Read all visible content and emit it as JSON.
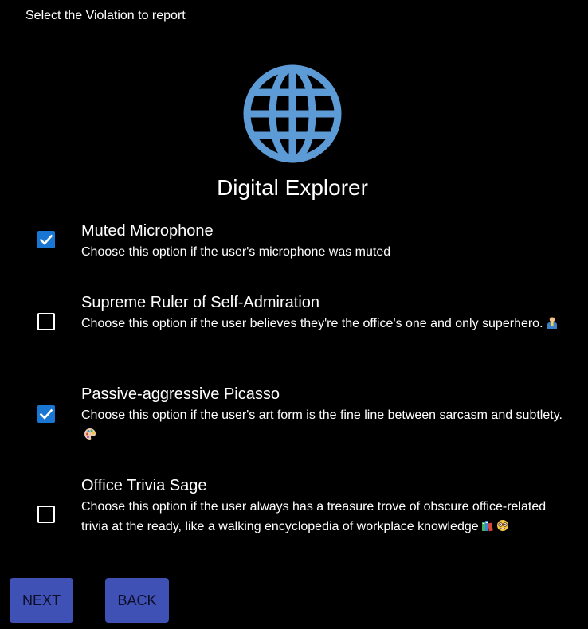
{
  "header": {
    "prompt": "Select the Violation to report"
  },
  "profile": {
    "icon": "globe-icon",
    "name": "Digital Explorer",
    "accent": "#5c9bd6"
  },
  "options": [
    {
      "title": "Muted Microphone",
      "description": "Choose this option if the user's microphone was muted",
      "checked": true
    },
    {
      "title": "Supreme Ruler of Self-Admiration",
      "description": "Choose this option if the user believes they're the office's one and only superhero.",
      "emoji": [
        "superhero-emoji"
      ],
      "checked": false
    },
    {
      "title": "Passive-aggressive Picasso",
      "description": "Choose this option if the user's art form is the fine line between sarcasm and subtlety.",
      "emoji": [
        "artist-palette-emoji"
      ],
      "checked": true
    },
    {
      "title": "Office Trivia Sage",
      "description": "Choose this option if the user always has a treasure trove of obscure office-related trivia at the ready, like a walking encyclopedia of workplace knowledge",
      "emoji": [
        "books-emoji",
        "nerd-face-emoji"
      ],
      "checked": false
    }
  ],
  "buttons": {
    "next_label": "NEXT",
    "back_label": "BACK",
    "color": "#3f51b5"
  },
  "checkbox_color": "#1976d2"
}
